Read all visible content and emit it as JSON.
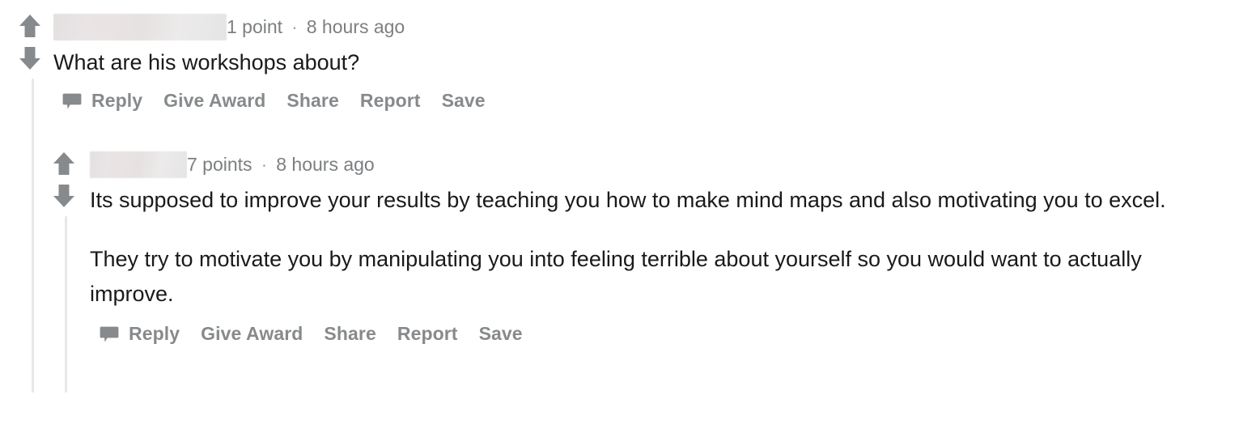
{
  "thread": {
    "comments": [
      {
        "id": "comment-1",
        "username_redacted": true,
        "score": "1 point",
        "separator": "·",
        "timestamp": "8 hours ago",
        "paragraphs": [
          "What are his workshops about?"
        ],
        "actions": [
          "Reply",
          "Give Award",
          "Share",
          "Report",
          "Save"
        ],
        "reply_icon": "speech-bubble-icon",
        "upvote_icon": "upvote-arrow-icon",
        "downvote_icon": "downvote-arrow-icon"
      },
      {
        "id": "comment-2",
        "username_redacted": true,
        "score": "7 points",
        "separator": "·",
        "timestamp": "8 hours ago",
        "paragraphs": [
          "Its supposed to improve your results by teaching you how to make mind maps and also motivating you to excel.",
          "They try to motivate you by manipulating you into feeling terrible about yourself so you would want to actually improve."
        ],
        "actions": [
          "Reply",
          "Give Award",
          "Share",
          "Report",
          "Save"
        ],
        "reply_icon": "speech-bubble-icon",
        "upvote_icon": "upvote-arrow-icon",
        "downvote_icon": "downvote-arrow-icon"
      }
    ]
  },
  "colors": {
    "body_text": "#1a1a1b",
    "meta_text": "#7c7f81",
    "action_text": "#878a8c",
    "arrow_fill": "#878a8c",
    "thread_line": "#e8e8e8",
    "background": "#ffffff"
  }
}
